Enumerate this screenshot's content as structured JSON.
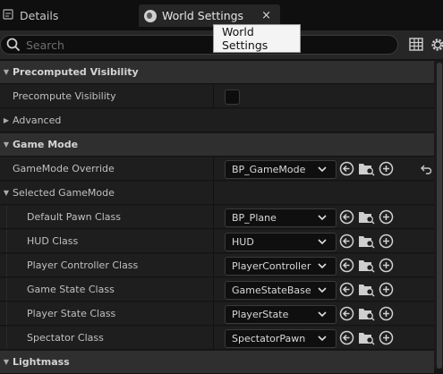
{
  "tabs": {
    "details_label": "Details",
    "world_label": "World Settings",
    "close_glyph": "×"
  },
  "tooltip": {
    "text": "World Settings"
  },
  "search": {
    "placeholder": "Search"
  },
  "sections": {
    "precomputed_visibility": {
      "label": "Precomputed Visibility",
      "precompute_label": "Precompute Visibility",
      "precompute_checked": false
    },
    "advanced": {
      "label": "Advanced"
    },
    "game_mode": {
      "label": "Game Mode",
      "override_label": "GameMode Override",
      "override_value": "BP_GameMode"
    },
    "selected_game_mode": {
      "label": "Selected GameMode",
      "items": [
        {
          "label": "Default Pawn Class",
          "value": "BP_Plane"
        },
        {
          "label": "HUD Class",
          "value": "HUD"
        },
        {
          "label": "Player Controller Class",
          "value": "PlayerController"
        },
        {
          "label": "Game State Class",
          "value": "GameStateBase"
        },
        {
          "label": "Player State Class",
          "value": "PlayerState"
        },
        {
          "label": "Spectator Class",
          "value": "SpectatorPawn"
        }
      ]
    },
    "lightmass": {
      "label": "Lightmass"
    }
  },
  "colors": {
    "background": "#1a1a1a",
    "category_row": "#2f2f2f",
    "tooltip_bg": "#f4f4f4"
  }
}
